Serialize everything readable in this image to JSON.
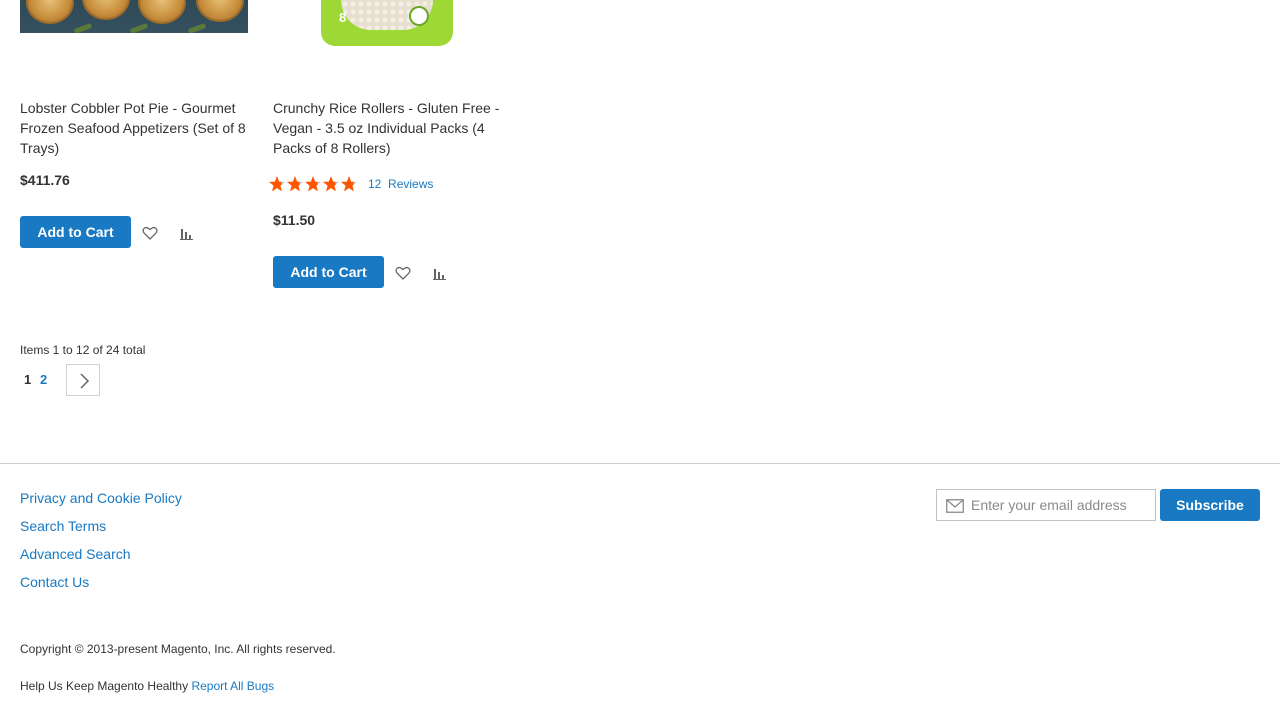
{
  "products": [
    {
      "name": "Lobster Cobbler Pot Pie - Gourmet Frozen Seafood Appetizers (Set of 8 Trays)",
      "price": "$411.76",
      "add_to_cart_label": "Add to Cart",
      "image_icon": "pot-pie-image"
    },
    {
      "name": "Crunchy Rice Rollers - Gluten Free - Vegan - 3.5 oz Individual Packs (4 Packs of 8 Rollers)",
      "price": "$11.50",
      "add_to_cart_label": "Add to Cart",
      "rating_fraction": 0.78,
      "review_count": "12",
      "reviews_label": "Reviews",
      "package_number": "8",
      "image_icon": "rice-rollers-image"
    }
  ],
  "toolbar": {
    "amount_text": "Items 1 to 12 of 24 total",
    "current_page": "1",
    "page_link": "2",
    "next_icon": "chevron-right-icon"
  },
  "footer": {
    "links": [
      "Privacy and Cookie Policy",
      "Search Terms",
      "Advanced Search",
      "Contact Us"
    ],
    "newsletter": {
      "placeholder": "Enter your email address",
      "subscribe_label": "Subscribe",
      "icon": "envelope-icon"
    },
    "copyright": "Copyright © 2013-present Magento, Inc. All rights reserved.",
    "help_text": "Help Us Keep Magento Healthy",
    "report_link": "Report All Bugs"
  },
  "colors": {
    "accent": "#1979c3",
    "star": "#ff5501",
    "star_empty": "#c7c7c7",
    "text": "#333333"
  }
}
